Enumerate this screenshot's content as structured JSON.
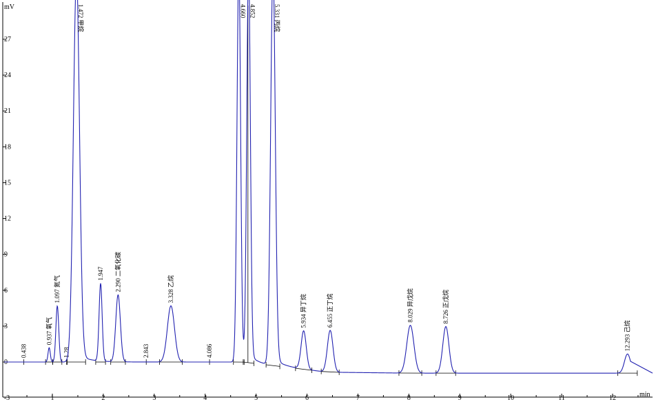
{
  "chart_data": {
    "type": "line",
    "ylabel": "mV",
    "xlabel": "min",
    "xlim": [
      -0.3,
      12.7
    ],
    "ylim": [
      -3,
      30
    ],
    "x_ticks": [
      "-3",
      "1",
      "2",
      "3",
      "4",
      "5",
      "6",
      "7",
      "8",
      "9",
      "10",
      "11",
      "12"
    ],
    "y_ticks": [
      "27",
      "24",
      "21",
      "18",
      "15",
      "12",
      "9",
      "6",
      "3",
      "0"
    ],
    "grid": false,
    "colors": {
      "trace": "#2020b0",
      "axis": "#000000"
    },
    "series": [
      {
        "peaks": [
          {
            "rt": 0.937,
            "height": 1.2,
            "width": 0.022,
            "label": "0.937 氧气"
          },
          {
            "rt": 1.097,
            "height": 4.7,
            "width": 0.028,
            "label": "1.097 氮气"
          },
          {
            "rt": 1.472,
            "height": 32.0,
            "width": 0.06,
            "label": "1.472 甲烷"
          },
          {
            "rt": 1.947,
            "height": 6.5,
            "width": 0.03,
            "label": "1.947"
          },
          {
            "rt": 2.29,
            "height": 5.6,
            "width": 0.045,
            "label": "2.290 二氧化碳"
          },
          {
            "rt": 3.328,
            "height": 4.7,
            "width": 0.07,
            "label": "3.328 乙烷"
          },
          {
            "rt": 4.66,
            "height": 33.0,
            "width": 0.035,
            "label": "4.660"
          },
          {
            "rt": 4.852,
            "height": 33.0,
            "width": 0.035,
            "label": "4.852"
          },
          {
            "rt": 5.331,
            "height": 33.0,
            "width": 0.045,
            "label": "5.331 丙烷"
          },
          {
            "rt": 5.934,
            "height": 3.2,
            "width": 0.05,
            "label": "5.934 异丁烷"
          },
          {
            "rt": 6.455,
            "height": 3.5,
            "width": 0.055,
            "label": "6.455 正丁烷"
          },
          {
            "rt": 8.029,
            "height": 4.0,
            "width": 0.07,
            "label": "8.029 异戊烷"
          },
          {
            "rt": 8.726,
            "height": 3.9,
            "width": 0.06,
            "label": "8.726 正戊烷"
          },
          {
            "rt": 12.293,
            "height": 1.6,
            "width": 0.06,
            "label": "12.293 己烷"
          }
        ]
      }
    ],
    "baseline_markers": [
      {
        "rt": 0.438,
        "label": "0.438"
      },
      {
        "rt": 1.28,
        "label": "1.28"
      },
      {
        "rt": 2.843,
        "label": "2.843"
      },
      {
        "rt": 4.086,
        "label": "4.086"
      }
    ]
  }
}
